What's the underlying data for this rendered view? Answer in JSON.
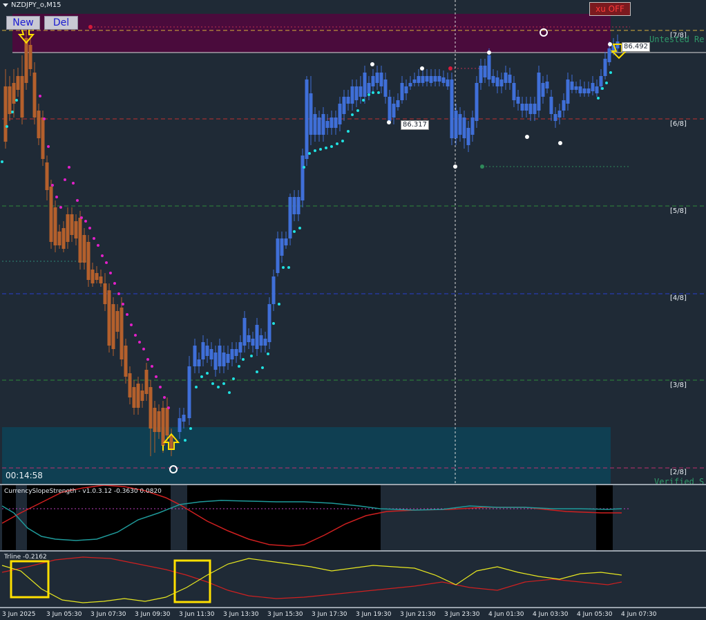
{
  "header": {
    "symbol": "NZDJPY_o,M15"
  },
  "toolbar": {
    "new_label": "New",
    "del_label": "Del",
    "xu_label": "xu OFF"
  },
  "timer": "00:14:58",
  "levels": [
    "[7/8]",
    "[6/8]",
    "[5/8]",
    "[4/8]",
    "[3/8]",
    "[2/8]"
  ],
  "zones": {
    "top_label": "Untested Re",
    "bottom_label": "Verified S"
  },
  "price_labels": {
    "high": "86.492",
    "mid": "86.317"
  },
  "indicators": {
    "currency_slope": "CurrencySlopeStrength - v1.0.3.12 -0.3630 0.0820",
    "trline": "Trline -0.2162"
  },
  "time_axis": [
    "3 Jun 2025",
    "3 Jun 05:30",
    "3 Jun 07:30",
    "3 Jun 09:30",
    "3 Jun 11:30",
    "3 Jun 13:30",
    "3 Jun 15:30",
    "3 Jun 17:30",
    "3 Jun 19:30",
    "3 Jun 21:30",
    "3 Jun 23:30",
    "4 Jun 01:30",
    "4 Jun 03:30",
    "4 Jun 05:30",
    "4 Jun 07:30"
  ],
  "colors": {
    "background": "#1f2a36",
    "bull_candle": "#3f6fd8",
    "bear_candle": "#b4602c",
    "supply_zone": "#4a0b3c",
    "demand_zone": "#0f3f52",
    "accent_yellow": "#ffe000"
  },
  "icons": [
    "double-arrow-down-icon",
    "double-arrow-up-icon",
    "price-dot-icon",
    "timer-icon"
  ]
}
